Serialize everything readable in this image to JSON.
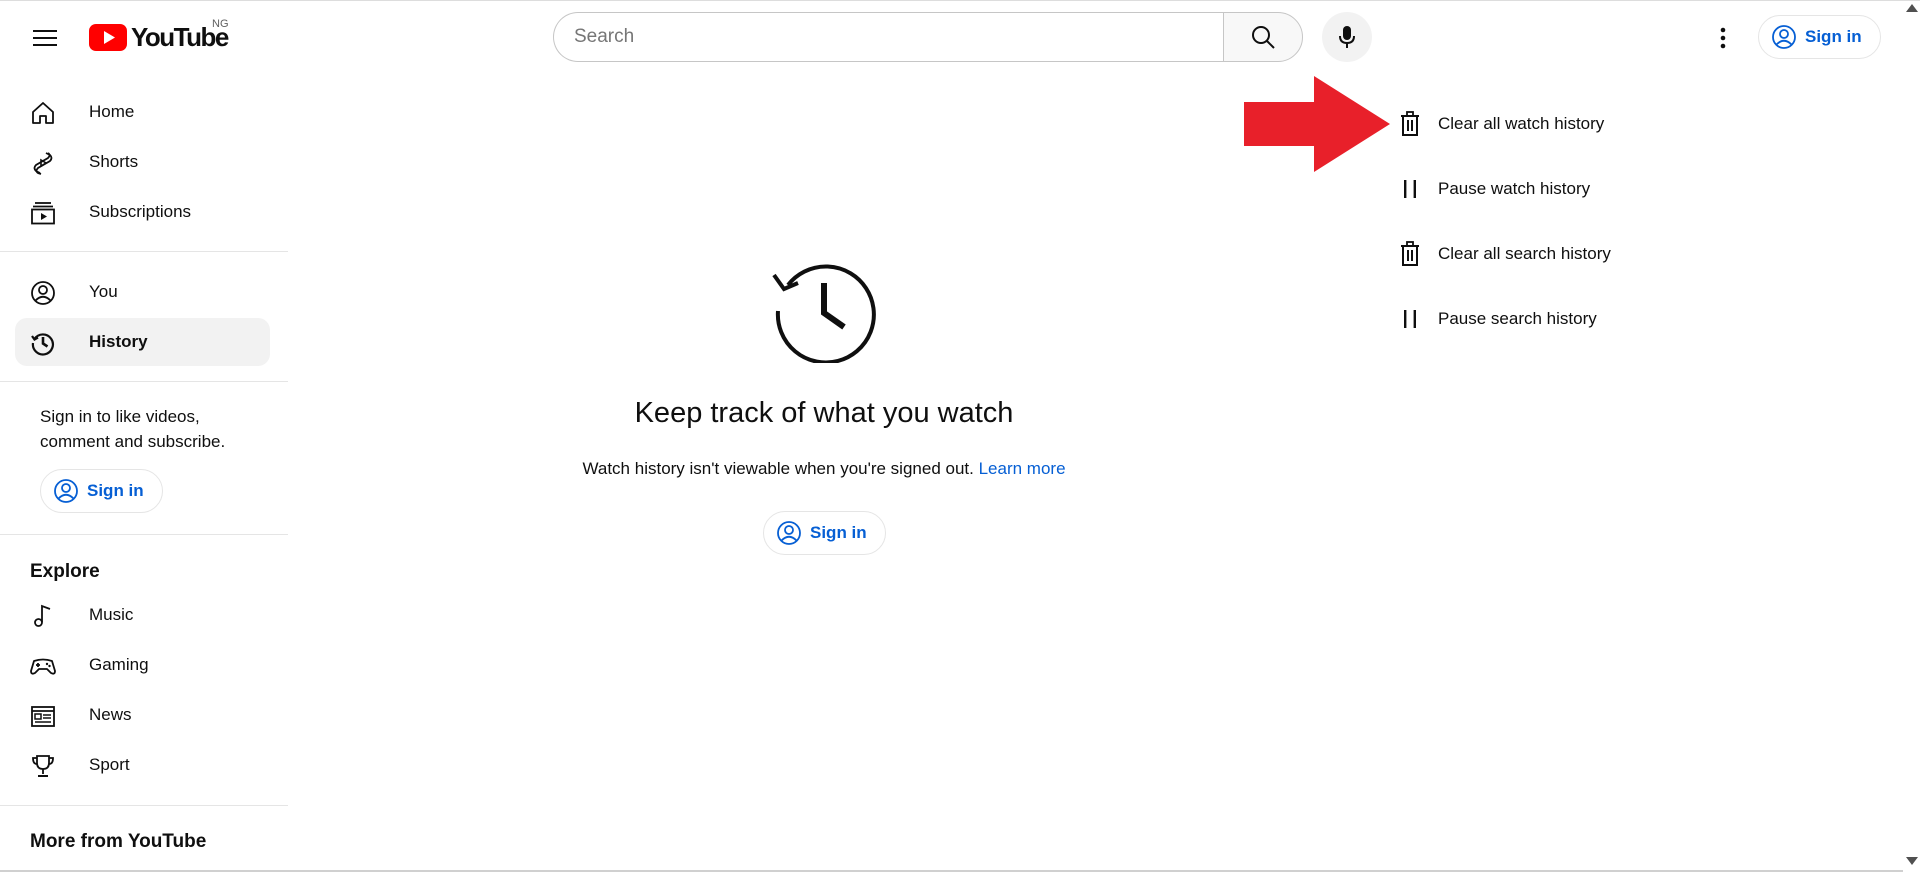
{
  "header": {
    "logo_text": "YouTube",
    "region": "NG",
    "search_placeholder": "Search",
    "signin_label": "Sign in"
  },
  "sidebar": {
    "main_items": [
      {
        "label": "Home",
        "icon": "home-icon"
      },
      {
        "label": "Shorts",
        "icon": "shorts-icon"
      },
      {
        "label": "Subscriptions",
        "icon": "subscriptions-icon"
      }
    ],
    "you_items": [
      {
        "label": "You",
        "icon": "account-icon"
      },
      {
        "label": "History",
        "icon": "history-icon",
        "active": true
      }
    ],
    "signin_prompt": "Sign in to like videos, comment and subscribe.",
    "signin_label": "Sign in",
    "explore_title": "Explore",
    "explore_items": [
      {
        "label": "Music",
        "icon": "music-icon"
      },
      {
        "label": "Gaming",
        "icon": "gaming-icon"
      },
      {
        "label": "News",
        "icon": "news-icon"
      },
      {
        "label": "Sport",
        "icon": "trophy-icon"
      }
    ],
    "more_title": "More from YouTube"
  },
  "main": {
    "empty_title": "Keep track of what you watch",
    "empty_subtitle": "Watch history isn't viewable when you're signed out.",
    "learn_more": "Learn more",
    "signin_label": "Sign in"
  },
  "actions": [
    {
      "label": "Clear all watch history",
      "icon": "trash-icon"
    },
    {
      "label": "Pause watch history",
      "icon": "pause-icon"
    },
    {
      "label": "Clear all search history",
      "icon": "trash-icon"
    },
    {
      "label": "Pause search history",
      "icon": "pause-icon"
    }
  ],
  "colors": {
    "brand_red": "#ff0000",
    "link_blue": "#065fd4",
    "annotation_arrow": "#e8202a",
    "active_bg": "#f2f2f2"
  }
}
